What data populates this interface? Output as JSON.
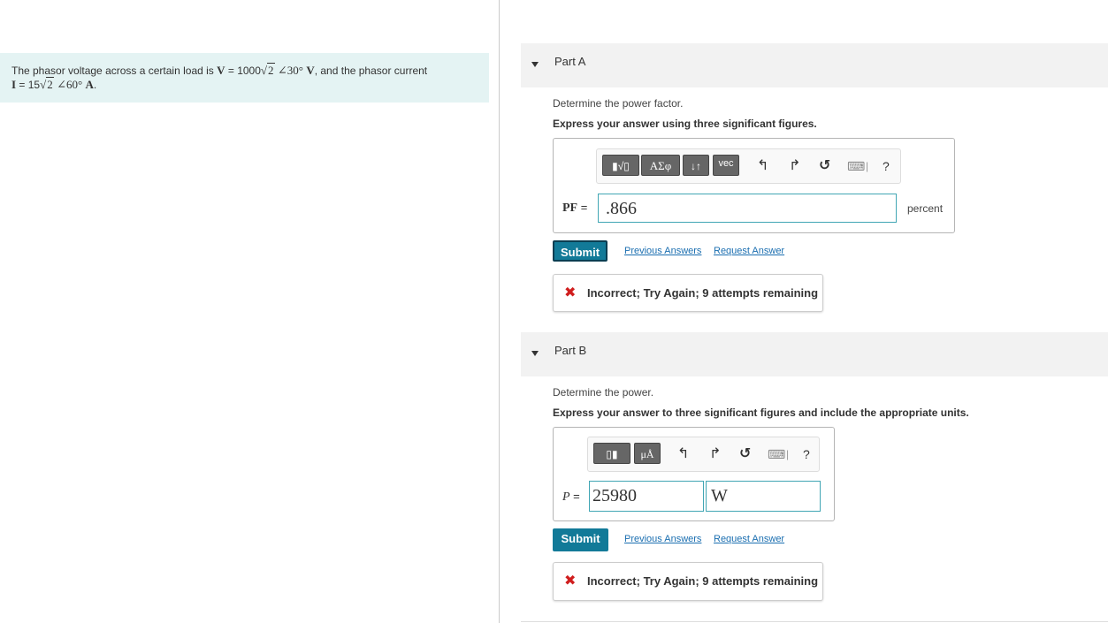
{
  "problem": {
    "line1_prefix": "The phasor voltage across a certain load is",
    "V_symbol": "V",
    "V_eq": " = 1000",
    "V_root": "2",
    "V_angle": "∠30°",
    "V_unit": "V",
    "line1_suffix": ", and the phasor current",
    "I_symbol": "I",
    "I_eq": " = 15",
    "I_root": "2",
    "I_angle": "∠60°",
    "I_unit": "A",
    "line2_suffix": "."
  },
  "partA": {
    "title": "Part A",
    "question": "Determine the power factor.",
    "instruction": "Express your answer using three significant figures.",
    "toolbar": {
      "templates": "▮√▯",
      "greek": "ΑΣφ",
      "sort": "↓↑",
      "vec": "vec",
      "undo": "↰",
      "redo": "↱",
      "reset": "↺",
      "keyboard": "⌨",
      "help": "?"
    },
    "var_label": "PF =",
    "answer_value": ".866",
    "unit_label": "percent",
    "submit_label": "Submit",
    "prev_label": "Previous Answers",
    "request_label": "Request Answer",
    "feedback_icon": "✖",
    "feedback": "Incorrect; Try Again; 9 attempts remaining"
  },
  "partB": {
    "title": "Part B",
    "question": "Determine the power.",
    "instruction": "Express your answer to three significant figures and include the appropriate units.",
    "toolbar": {
      "templates": "▯▮",
      "units": "μÅ",
      "undo": "↰",
      "redo": "↱",
      "reset": "↺",
      "keyboard": "⌨",
      "help": "?"
    },
    "var_label": "P =",
    "answer_value": "25980",
    "answer_unit": "W",
    "submit_label": "Submit",
    "prev_label": "Previous Answers",
    "request_label": "Request Answer",
    "feedback_icon": "✖",
    "feedback": "Incorrect; Try Again; 9 attempts remaining"
  }
}
